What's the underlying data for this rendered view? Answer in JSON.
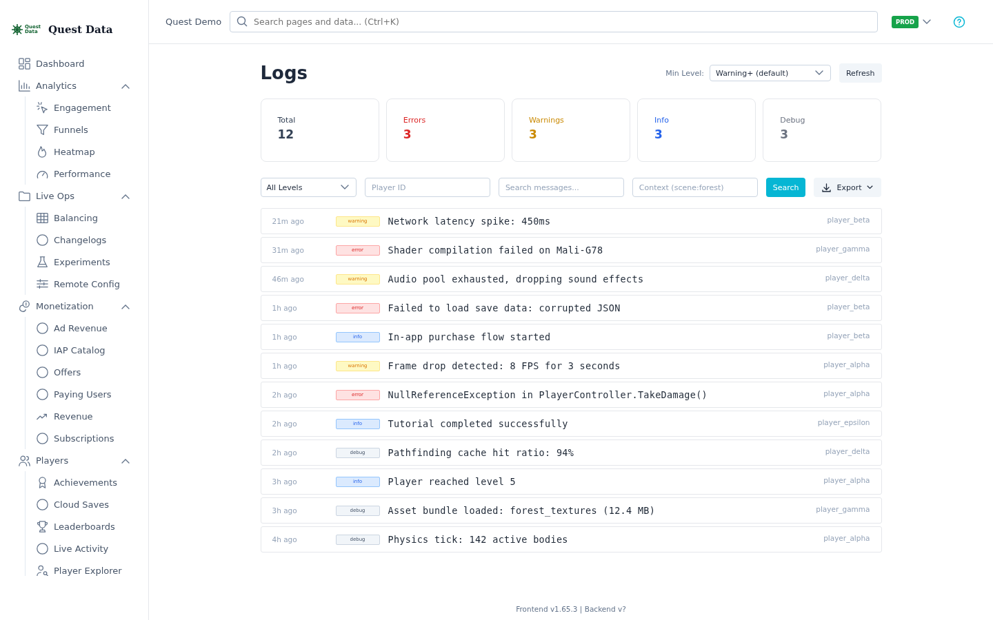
{
  "brand": {
    "logo_text": "Quest Data",
    "name": "Quest Data"
  },
  "sidebar": {
    "items": [
      {
        "label": "Dashboard",
        "kind": "link"
      },
      {
        "label": "Analytics",
        "kind": "group",
        "expanded": true,
        "children": [
          {
            "label": "Engagement"
          },
          {
            "label": "Funnels"
          },
          {
            "label": "Heatmap"
          },
          {
            "label": "Performance"
          }
        ]
      },
      {
        "label": "Live Ops",
        "kind": "group",
        "expanded": true,
        "children": [
          {
            "label": "Balancing"
          },
          {
            "label": "Changelogs"
          },
          {
            "label": "Experiments"
          },
          {
            "label": "Remote Config"
          }
        ]
      },
      {
        "label": "Monetization",
        "kind": "group",
        "expanded": true,
        "children": [
          {
            "label": "Ad Revenue"
          },
          {
            "label": "IAP Catalog"
          },
          {
            "label": "Offers"
          },
          {
            "label": "Paying Users"
          },
          {
            "label": "Revenue"
          },
          {
            "label": "Subscriptions"
          }
        ]
      },
      {
        "label": "Players",
        "kind": "group",
        "expanded": true,
        "children": [
          {
            "label": "Achievements"
          },
          {
            "label": "Cloud Saves"
          },
          {
            "label": "Leaderboards"
          },
          {
            "label": "Live Activity"
          },
          {
            "label": "Player Explorer"
          }
        ]
      }
    ]
  },
  "header": {
    "project": "Quest Demo",
    "search": {
      "placeholder": "Search pages and data... (Ctrl+K)"
    },
    "environment": "PROD"
  },
  "page": {
    "title": "Logs",
    "min_level": {
      "label": "Min Level:",
      "value": "Warning+ (default)"
    },
    "refresh": "Refresh"
  },
  "stats": [
    {
      "label": "Total",
      "value": "12",
      "color": "#334155"
    },
    {
      "label": "Errors",
      "value": "3",
      "color": "#dc2626"
    },
    {
      "label": "Warnings",
      "value": "3",
      "color": "#ca8a04"
    },
    {
      "label": "Info",
      "value": "3",
      "color": "#2563eb"
    },
    {
      "label": "Debug",
      "value": "3",
      "color": "#6b7280"
    }
  ],
  "filters": {
    "level": "All Levels",
    "player": {
      "placeholder": "Player ID"
    },
    "message": {
      "placeholder": "Search messages..."
    },
    "context": {
      "placeholder": "Context (scene:forest)"
    },
    "search": "Search",
    "export": "Export"
  },
  "logs": [
    {
      "time": "21m ago",
      "level": "warning",
      "message": "Network latency spike: 450ms",
      "player": "player_beta"
    },
    {
      "time": "31m ago",
      "level": "error",
      "message": "Shader compilation failed on Mali-G78",
      "player": "player_gamma"
    },
    {
      "time": "46m ago",
      "level": "warning",
      "message": "Audio pool exhausted, dropping sound effects",
      "player": "player_delta"
    },
    {
      "time": "1h ago",
      "level": "error",
      "message": "Failed to load save data: corrupted JSON",
      "player": "player_beta"
    },
    {
      "time": "1h ago",
      "level": "info",
      "message": "In-app purchase flow started",
      "player": "player_beta"
    },
    {
      "time": "1h ago",
      "level": "warning",
      "message": "Frame drop detected: 8 FPS for 3 seconds",
      "player": "player_alpha"
    },
    {
      "time": "2h ago",
      "level": "error",
      "message": "NullReferenceException in PlayerController.TakeDamage()",
      "player": "player_alpha"
    },
    {
      "time": "2h ago",
      "level": "info",
      "message": "Tutorial completed successfully",
      "player": "player_epsilon"
    },
    {
      "time": "2h ago",
      "level": "debug",
      "message": "Pathfinding cache hit ratio: 94%",
      "player": "player_delta"
    },
    {
      "time": "3h ago",
      "level": "info",
      "message": "Player reached level 5",
      "player": "player_alpha"
    },
    {
      "time": "3h ago",
      "level": "debug",
      "message": "Asset bundle loaded: forest_textures (12.4 MB)",
      "player": "player_gamma"
    },
    {
      "time": "4h ago",
      "level": "debug",
      "message": "Physics tick: 142 active bodies",
      "player": "player_alpha"
    }
  ],
  "footer": "Frontend v1.65.3 | Backend v?"
}
